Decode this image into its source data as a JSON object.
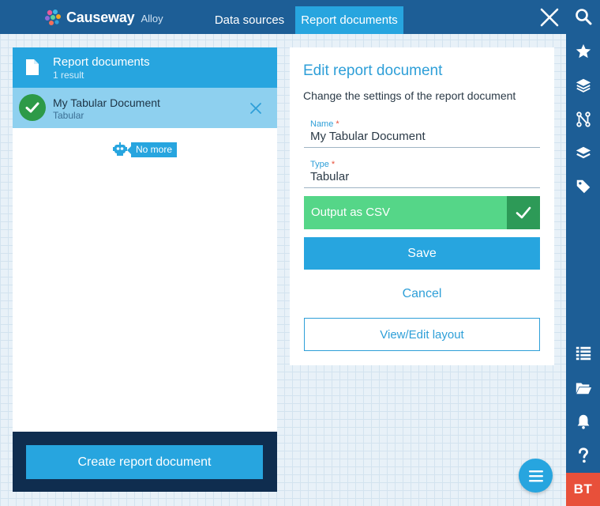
{
  "brand": {
    "name": "Causeway",
    "product": "Alloy"
  },
  "tabs": [
    {
      "label": "Data sources",
      "active": false
    },
    {
      "label": "Report documents",
      "active": true
    }
  ],
  "rail": {
    "icons": [
      "search-icon",
      "star-icon",
      "layers-icon",
      "branch-icon",
      "stack-icon",
      "tag-icon",
      "list-icon",
      "folder-icon",
      "bell-icon",
      "help-icon"
    ],
    "user_initials": "BT"
  },
  "list_panel": {
    "title": "Report documents",
    "count": "1 result",
    "items": [
      {
        "title": "My Tabular Document",
        "subtitle": "Tabular",
        "selected": true
      }
    ],
    "end_label": "No more",
    "create_label": "Create report document"
  },
  "form": {
    "title": "Edit report document",
    "description": "Change the settings of the report document",
    "name_label": "Name",
    "name_value": "My Tabular Document",
    "type_label": "Type",
    "type_value": "Tabular",
    "required_mark": "*",
    "csv_label": "Output as CSV",
    "csv_checked": true,
    "save_label": "Save",
    "cancel_label": "Cancel",
    "layout_label": "View/Edit layout"
  },
  "colors": {
    "nav": "#1d5e96",
    "accent": "#27a5df",
    "selected_row": "#8ed0ef",
    "success": "#55d688",
    "user_badge": "#e8503a"
  }
}
